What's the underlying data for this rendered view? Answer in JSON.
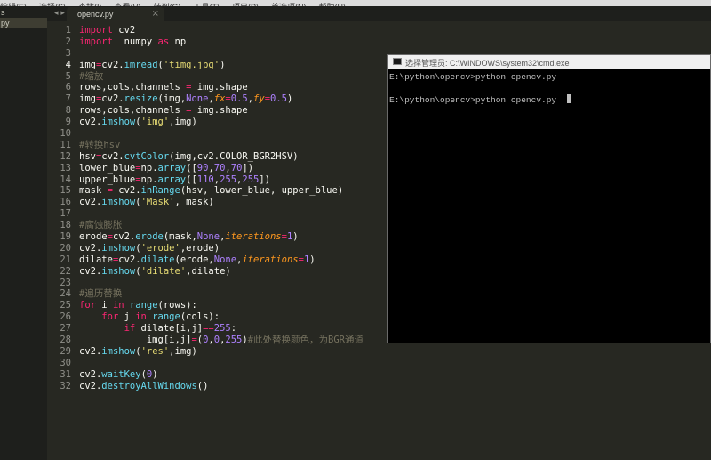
{
  "menu": [
    "编辑(E)",
    "选择(S)",
    "查找(I)",
    "查看(V)",
    "转到(G)",
    "工具(T)",
    "项目(P)",
    "首选项(N)",
    "帮助(H)"
  ],
  "sidebar": {
    "items": [
      {
        "label": "s"
      },
      {
        "label": "py"
      }
    ]
  },
  "tabs": {
    "active": {
      "label": "opencv.py"
    },
    "close_glyph": "×",
    "nav_glyph": "◂ ▸"
  },
  "editor": {
    "active_line": 4,
    "lines": [
      {
        "n": "1",
        "segs": [
          {
            "t": "import",
            "c": "kw"
          },
          {
            "t": " cv2",
            "c": ""
          }
        ]
      },
      {
        "n": "2",
        "segs": [
          {
            "t": "import",
            "c": "kw"
          },
          {
            "t": "  numpy ",
            "c": ""
          },
          {
            "t": "as",
            "c": "kw"
          },
          {
            "t": " np",
            "c": ""
          }
        ]
      },
      {
        "n": "3",
        "segs": []
      },
      {
        "n": "4",
        "segs": [
          {
            "t": "img",
            "c": ""
          },
          {
            "t": "=",
            "c": "op"
          },
          {
            "t": "cv2.",
            "c": ""
          },
          {
            "t": "imread",
            "c": "fn"
          },
          {
            "t": "(",
            "c": ""
          },
          {
            "t": "'timg.jpg'",
            "c": "str"
          },
          {
            "t": ")",
            "c": ""
          }
        ]
      },
      {
        "n": "5",
        "segs": [
          {
            "t": "#缩放",
            "c": "cm"
          }
        ]
      },
      {
        "n": "6",
        "segs": [
          {
            "t": "rows,cols,channels ",
            "c": ""
          },
          {
            "t": "=",
            "c": "op"
          },
          {
            "t": " img.shape",
            "c": ""
          }
        ]
      },
      {
        "n": "7",
        "segs": [
          {
            "t": "img",
            "c": ""
          },
          {
            "t": "=",
            "c": "op"
          },
          {
            "t": "cv2.",
            "c": ""
          },
          {
            "t": "resize",
            "c": "fn"
          },
          {
            "t": "(img,",
            "c": ""
          },
          {
            "t": "None",
            "c": "num"
          },
          {
            "t": ",",
            "c": ""
          },
          {
            "t": "fx",
            "c": "par"
          },
          {
            "t": "=",
            "c": "op"
          },
          {
            "t": "0.5",
            "c": "num"
          },
          {
            "t": ",",
            "c": ""
          },
          {
            "t": "fy",
            "c": "par"
          },
          {
            "t": "=",
            "c": "op"
          },
          {
            "t": "0.5",
            "c": "num"
          },
          {
            "t": ")",
            "c": ""
          }
        ]
      },
      {
        "n": "8",
        "segs": [
          {
            "t": "rows,cols,channels ",
            "c": ""
          },
          {
            "t": "=",
            "c": "op"
          },
          {
            "t": " img.shape",
            "c": ""
          }
        ]
      },
      {
        "n": "9",
        "segs": [
          {
            "t": "cv2.",
            "c": ""
          },
          {
            "t": "imshow",
            "c": "fn"
          },
          {
            "t": "(",
            "c": ""
          },
          {
            "t": "'img'",
            "c": "str"
          },
          {
            "t": ",img)",
            "c": ""
          }
        ]
      },
      {
        "n": "10",
        "segs": []
      },
      {
        "n": "11",
        "segs": [
          {
            "t": "#转换hsv",
            "c": "cm"
          }
        ]
      },
      {
        "n": "12",
        "segs": [
          {
            "t": "hsv",
            "c": ""
          },
          {
            "t": "=",
            "c": "op"
          },
          {
            "t": "cv2.",
            "c": ""
          },
          {
            "t": "cvtColor",
            "c": "fn"
          },
          {
            "t": "(img,cv2.COLOR_BGR2HSV)",
            "c": ""
          }
        ]
      },
      {
        "n": "13",
        "segs": [
          {
            "t": "lower_blue",
            "c": ""
          },
          {
            "t": "=",
            "c": "op"
          },
          {
            "t": "np.",
            "c": ""
          },
          {
            "t": "array",
            "c": "fn"
          },
          {
            "t": "([",
            "c": ""
          },
          {
            "t": "90",
            "c": "num"
          },
          {
            "t": ",",
            "c": ""
          },
          {
            "t": "70",
            "c": "num"
          },
          {
            "t": ",",
            "c": ""
          },
          {
            "t": "70",
            "c": "num"
          },
          {
            "t": "])",
            "c": ""
          }
        ]
      },
      {
        "n": "14",
        "segs": [
          {
            "t": "upper_blue",
            "c": ""
          },
          {
            "t": "=",
            "c": "op"
          },
          {
            "t": "np.",
            "c": ""
          },
          {
            "t": "array",
            "c": "fn"
          },
          {
            "t": "([",
            "c": ""
          },
          {
            "t": "110",
            "c": "num"
          },
          {
            "t": ",",
            "c": ""
          },
          {
            "t": "255",
            "c": "num"
          },
          {
            "t": ",",
            "c": ""
          },
          {
            "t": "255",
            "c": "num"
          },
          {
            "t": "])",
            "c": ""
          }
        ]
      },
      {
        "n": "15",
        "segs": [
          {
            "t": "mask ",
            "c": ""
          },
          {
            "t": "=",
            "c": "op"
          },
          {
            "t": " cv2.",
            "c": ""
          },
          {
            "t": "inRange",
            "c": "fn"
          },
          {
            "t": "(hsv, lower_blue, upper_blue)",
            "c": ""
          }
        ]
      },
      {
        "n": "16",
        "segs": [
          {
            "t": "cv2.",
            "c": ""
          },
          {
            "t": "imshow",
            "c": "fn"
          },
          {
            "t": "(",
            "c": ""
          },
          {
            "t": "'Mask'",
            "c": "str"
          },
          {
            "t": ", mask)",
            "c": ""
          }
        ]
      },
      {
        "n": "17",
        "segs": []
      },
      {
        "n": "18",
        "segs": [
          {
            "t": "#腐蚀膨胀",
            "c": "cm"
          }
        ]
      },
      {
        "n": "19",
        "segs": [
          {
            "t": "erode",
            "c": ""
          },
          {
            "t": "=",
            "c": "op"
          },
          {
            "t": "cv2.",
            "c": ""
          },
          {
            "t": "erode",
            "c": "fn"
          },
          {
            "t": "(mask,",
            "c": ""
          },
          {
            "t": "None",
            "c": "num"
          },
          {
            "t": ",",
            "c": ""
          },
          {
            "t": "iterations",
            "c": "par"
          },
          {
            "t": "=",
            "c": "op"
          },
          {
            "t": "1",
            "c": "num"
          },
          {
            "t": ")",
            "c": ""
          }
        ]
      },
      {
        "n": "20",
        "segs": [
          {
            "t": "cv2.",
            "c": ""
          },
          {
            "t": "imshow",
            "c": "fn"
          },
          {
            "t": "(",
            "c": ""
          },
          {
            "t": "'erode'",
            "c": "str"
          },
          {
            "t": ",erode)",
            "c": ""
          }
        ]
      },
      {
        "n": "21",
        "segs": [
          {
            "t": "dilate",
            "c": ""
          },
          {
            "t": "=",
            "c": "op"
          },
          {
            "t": "cv2.",
            "c": ""
          },
          {
            "t": "dilate",
            "c": "fn"
          },
          {
            "t": "(erode,",
            "c": ""
          },
          {
            "t": "None",
            "c": "num"
          },
          {
            "t": ",",
            "c": ""
          },
          {
            "t": "iterations",
            "c": "par"
          },
          {
            "t": "=",
            "c": "op"
          },
          {
            "t": "1",
            "c": "num"
          },
          {
            "t": ")",
            "c": ""
          }
        ]
      },
      {
        "n": "22",
        "segs": [
          {
            "t": "cv2.",
            "c": ""
          },
          {
            "t": "imshow",
            "c": "fn"
          },
          {
            "t": "(",
            "c": ""
          },
          {
            "t": "'dilate'",
            "c": "str"
          },
          {
            "t": ",dilate)",
            "c": ""
          }
        ]
      },
      {
        "n": "23",
        "segs": []
      },
      {
        "n": "24",
        "segs": [
          {
            "t": "#遍历替换",
            "c": "cm"
          }
        ]
      },
      {
        "n": "25",
        "segs": [
          {
            "t": "for",
            "c": "kw"
          },
          {
            "t": " i ",
            "c": ""
          },
          {
            "t": "in",
            "c": "kw"
          },
          {
            "t": " ",
            "c": ""
          },
          {
            "t": "range",
            "c": "fn"
          },
          {
            "t": "(rows):",
            "c": ""
          }
        ]
      },
      {
        "n": "26",
        "segs": [
          {
            "t": "    ",
            "c": ""
          },
          {
            "t": "for",
            "c": "kw"
          },
          {
            "t": " j ",
            "c": ""
          },
          {
            "t": "in",
            "c": "kw"
          },
          {
            "t": " ",
            "c": ""
          },
          {
            "t": "range",
            "c": "fn"
          },
          {
            "t": "(cols):",
            "c": ""
          }
        ]
      },
      {
        "n": "27",
        "segs": [
          {
            "t": "        ",
            "c": ""
          },
          {
            "t": "if",
            "c": "kw"
          },
          {
            "t": " dilate[i,j]",
            "c": ""
          },
          {
            "t": "==",
            "c": "op"
          },
          {
            "t": "255",
            "c": "num"
          },
          {
            "t": ":",
            "c": ""
          }
        ]
      },
      {
        "n": "28",
        "segs": [
          {
            "t": "            img[i,j]",
            "c": ""
          },
          {
            "t": "=",
            "c": "op"
          },
          {
            "t": "(",
            "c": ""
          },
          {
            "t": "0",
            "c": "num"
          },
          {
            "t": ",",
            "c": ""
          },
          {
            "t": "0",
            "c": "num"
          },
          {
            "t": ",",
            "c": ""
          },
          {
            "t": "255",
            "c": "num"
          },
          {
            "t": ")",
            "c": ""
          },
          {
            "t": "#此处替换颜色，为BGR通道",
            "c": "cm"
          }
        ]
      },
      {
        "n": "29",
        "segs": [
          {
            "t": "cv2.",
            "c": ""
          },
          {
            "t": "imshow",
            "c": "fn"
          },
          {
            "t": "(",
            "c": ""
          },
          {
            "t": "'res'",
            "c": "str"
          },
          {
            "t": ",img)",
            "c": ""
          }
        ]
      },
      {
        "n": "30",
        "segs": []
      },
      {
        "n": "31",
        "segs": [
          {
            "t": "cv2.",
            "c": ""
          },
          {
            "t": "waitKey",
            "c": "fn"
          },
          {
            "t": "(",
            "c": ""
          },
          {
            "t": "0",
            "c": "num"
          },
          {
            "t": ")",
            "c": ""
          }
        ]
      },
      {
        "n": "32",
        "segs": [
          {
            "t": "cv2.",
            "c": ""
          },
          {
            "t": "destroyAllWindows",
            "c": "fn"
          },
          {
            "t": "()",
            "c": ""
          }
        ]
      }
    ]
  },
  "cmd": {
    "title": "选择管理员: C:\\WINDOWS\\system32\\cmd.exe",
    "lines": [
      "E:\\python\\opencv>python opencv.py",
      "",
      "E:\\python\\opencv>python opencv.py  "
    ]
  }
}
